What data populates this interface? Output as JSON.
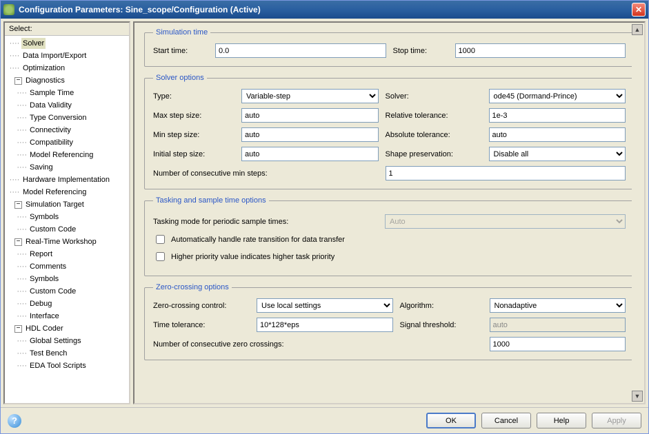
{
  "window": {
    "title": "Configuration Parameters: Sine_scope/Configuration (Active)"
  },
  "sidebar": {
    "header": "Select:",
    "items": [
      {
        "label": "Solver",
        "depth": 1,
        "selected": true
      },
      {
        "label": "Data Import/Export",
        "depth": 1
      },
      {
        "label": "Optimization",
        "depth": 1
      },
      {
        "label": "Diagnostics",
        "depth": 1,
        "expandable": true
      },
      {
        "label": "Sample Time",
        "depth": 2
      },
      {
        "label": "Data Validity",
        "depth": 2
      },
      {
        "label": "Type Conversion",
        "depth": 2
      },
      {
        "label": "Connectivity",
        "depth": 2
      },
      {
        "label": "Compatibility",
        "depth": 2
      },
      {
        "label": "Model Referencing",
        "depth": 2
      },
      {
        "label": "Saving",
        "depth": 2
      },
      {
        "label": "Hardware Implementation",
        "depth": 1
      },
      {
        "label": "Model Referencing",
        "depth": 1
      },
      {
        "label": "Simulation Target",
        "depth": 1,
        "expandable": true
      },
      {
        "label": "Symbols",
        "depth": 2
      },
      {
        "label": "Custom Code",
        "depth": 2
      },
      {
        "label": "Real-Time Workshop",
        "depth": 1,
        "expandable": true
      },
      {
        "label": "Report",
        "depth": 2
      },
      {
        "label": "Comments",
        "depth": 2
      },
      {
        "label": "Symbols",
        "depth": 2
      },
      {
        "label": "Custom Code",
        "depth": 2
      },
      {
        "label": "Debug",
        "depth": 2
      },
      {
        "label": "Interface",
        "depth": 2
      },
      {
        "label": "HDL Coder",
        "depth": 1,
        "expandable": true
      },
      {
        "label": "Global Settings",
        "depth": 2
      },
      {
        "label": "Test Bench",
        "depth": 2
      },
      {
        "label": "EDA Tool Scripts",
        "depth": 2
      }
    ]
  },
  "groups": {
    "sim_time": {
      "legend": "Simulation time",
      "start_label": "Start time:",
      "start_value": "0.0",
      "stop_label": "Stop time:",
      "stop_value": "1000"
    },
    "solver": {
      "legend": "Solver options",
      "type_label": "Type:",
      "type_value": "Variable-step",
      "solver_label": "Solver:",
      "solver_value": "ode45 (Dormand-Prince)",
      "maxstep_label": "Max step size:",
      "maxstep_value": "auto",
      "reltol_label": "Relative tolerance:",
      "reltol_value": "1e-3",
      "minstep_label": "Min step size:",
      "minstep_value": "auto",
      "abstol_label": "Absolute tolerance:",
      "abstol_value": "auto",
      "initstep_label": "Initial step size:",
      "initstep_value": "auto",
      "shape_label": "Shape preservation:",
      "shape_value": "Disable all",
      "consec_label": "Number of consecutive min steps:",
      "consec_value": "1"
    },
    "tasking": {
      "legend": "Tasking and sample time options",
      "mode_label": "Tasking mode for periodic sample times:",
      "mode_value": "Auto",
      "cb1": "Automatically handle rate transition for data transfer",
      "cb2": "Higher priority value indicates higher task priority"
    },
    "zc": {
      "legend": "Zero-crossing options",
      "control_label": "Zero-crossing control:",
      "control_value": "Use local settings",
      "algo_label": "Algorithm:",
      "algo_value": "Nonadaptive",
      "timetol_label": "Time tolerance:",
      "timetol_value": "10*128*eps",
      "sigthresh_label": "Signal threshold:",
      "sigthresh_value": "auto",
      "consec_label": "Number of consecutive zero crossings:",
      "consec_value": "1000"
    }
  },
  "buttons": {
    "ok": "OK",
    "cancel": "Cancel",
    "help": "Help",
    "apply": "Apply"
  }
}
